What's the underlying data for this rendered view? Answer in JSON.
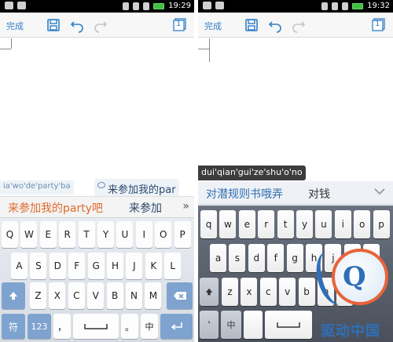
{
  "left": {
    "status": {
      "time": "19:29"
    },
    "toolbar": {
      "done_label": "完成",
      "page_count": "1"
    },
    "composition": {
      "pinyin": "ia'wo'de'party'ba",
      "hint": "来参加我的par"
    },
    "candidates": {
      "first": "来参加我的party吧",
      "second": "来参加",
      "more": "»"
    },
    "keyboard": {
      "row1": [
        "Q",
        "W",
        "E",
        "R",
        "T",
        "Y",
        "U",
        "I",
        "O",
        "P"
      ],
      "row2": [
        "A",
        "S",
        "D",
        "F",
        "G",
        "H",
        "J",
        "K",
        "L"
      ],
      "row3": [
        "Z",
        "X",
        "C",
        "V",
        "B",
        "N",
        "M"
      ],
      "symbol_key": "符",
      "num_key": "123",
      "comma_key": "，",
      "period_key": "。",
      "lang_key": "中"
    }
  },
  "right": {
    "status": {
      "time": "19:32"
    },
    "toolbar": {
      "done_label": "完成",
      "page_count": "1"
    },
    "composition": {
      "pinyin": "dui'qian'gui'ze'shu'o'no"
    },
    "candidates": {
      "first": "对潜规则书哦弄",
      "second": "对钱"
    },
    "keyboard": {
      "row1": [
        "q",
        "w",
        "e",
        "r",
        "t",
        "y",
        "u",
        "i",
        "o",
        "p"
      ],
      "row2": [
        "a",
        "s",
        "d",
        "f",
        "g",
        "h",
        "j",
        "k",
        "l"
      ],
      "row3": [
        "z",
        "x",
        "c",
        "v",
        "b",
        "n",
        "m"
      ],
      "lang_key": "中",
      "apostrophe_key": "'"
    }
  },
  "watermark": {
    "text": "驱动中国",
    "letter": "Q"
  },
  "colors": {
    "accent": "#2f7fc6",
    "candidate_highlight": "#e06a2a",
    "watermark_blue": "#2f6fb7",
    "watermark_orange": "#e8643a"
  }
}
